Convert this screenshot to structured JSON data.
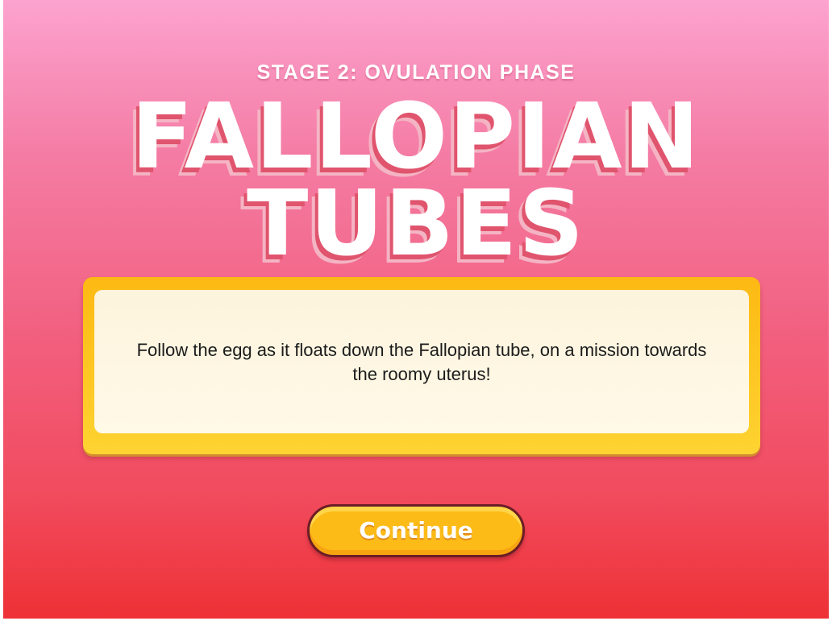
{
  "stage": {
    "subtitle": "STAGE 2: OVULATION PHASE",
    "title_line1": "FALLOPIAN",
    "title_line2": "TUBES"
  },
  "card": {
    "text": "Follow the egg as it floats down the Fallopian tube, on a mission towards the roomy uterus!"
  },
  "continue_button": {
    "label": "Continue"
  },
  "colors": {
    "background_top": "#fca3cf",
    "background_bottom": "#ee3135",
    "title_shadow": "#e0546d",
    "card_border": "#fdb913",
    "card_fill": "#fdf4dd",
    "button_fill": "#fdbb18",
    "button_outline": "#6a1e26"
  }
}
